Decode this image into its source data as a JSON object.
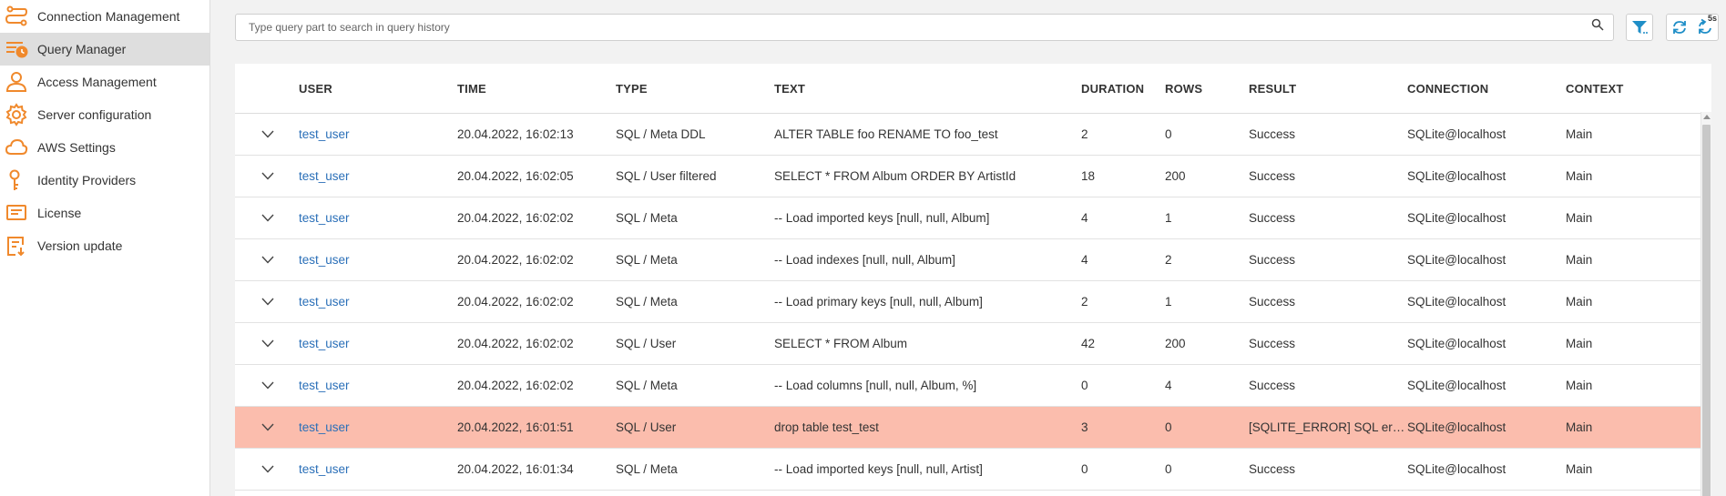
{
  "sidebar": {
    "items": [
      {
        "label": "Connection Management",
        "icon": "connections-icon"
      },
      {
        "label": "Query Manager",
        "icon": "query-manager-icon",
        "active": true
      },
      {
        "label": "Access Management",
        "icon": "user-icon"
      },
      {
        "label": "Server configuration",
        "icon": "gear-icon"
      },
      {
        "label": "AWS Settings",
        "icon": "cloud-icon"
      },
      {
        "label": "Identity Providers",
        "icon": "key-icon"
      },
      {
        "label": "License",
        "icon": "license-icon"
      },
      {
        "label": "Version update",
        "icon": "version-update-icon"
      }
    ]
  },
  "toolbar": {
    "search_placeholder": "Type query part to search in query history",
    "refresh_interval_badge": "5s"
  },
  "table": {
    "columns": [
      "USER",
      "TIME",
      "TYPE",
      "TEXT",
      "DURATION",
      "ROWS",
      "RESULT",
      "CONNECTION",
      "CONTEXT"
    ],
    "rows": [
      {
        "user": "test_user",
        "time": "20.04.2022, 16:02:13",
        "type": "SQL / Meta DDL",
        "text": "ALTER TABLE foo RENAME TO foo_test",
        "duration": "2",
        "rows": "0",
        "result": "Success",
        "connection": "SQLite@localhost",
        "context": "Main"
      },
      {
        "user": "test_user",
        "time": "20.04.2022, 16:02:05",
        "type": "SQL / User filtered",
        "text": "SELECT * FROM Album ORDER BY ArtistId",
        "duration": "18",
        "rows": "200",
        "result": "Success",
        "connection": "SQLite@localhost",
        "context": "Main"
      },
      {
        "user": "test_user",
        "time": "20.04.2022, 16:02:02",
        "type": "SQL / Meta",
        "text": "-- Load imported keys [null, null, Album]",
        "duration": "4",
        "rows": "1",
        "result": "Success",
        "connection": "SQLite@localhost",
        "context": "Main"
      },
      {
        "user": "test_user",
        "time": "20.04.2022, 16:02:02",
        "type": "SQL / Meta",
        "text": "-- Load indexes [null, null, Album]",
        "duration": "4",
        "rows": "2",
        "result": "Success",
        "connection": "SQLite@localhost",
        "context": "Main"
      },
      {
        "user": "test_user",
        "time": "20.04.2022, 16:02:02",
        "type": "SQL / Meta",
        "text": "-- Load primary keys [null, null, Album]",
        "duration": "2",
        "rows": "1",
        "result": "Success",
        "connection": "SQLite@localhost",
        "context": "Main"
      },
      {
        "user": "test_user",
        "time": "20.04.2022, 16:02:02",
        "type": "SQL / User",
        "text": "SELECT * FROM Album",
        "duration": "42",
        "rows": "200",
        "result": "Success",
        "connection": "SQLite@localhost",
        "context": "Main"
      },
      {
        "user": "test_user",
        "time": "20.04.2022, 16:02:02",
        "type": "SQL / Meta",
        "text": "-- Load columns [null, null, Album, %]",
        "duration": "0",
        "rows": "4",
        "result": "Success",
        "connection": "SQLite@localhost",
        "context": "Main"
      },
      {
        "user": "test_user",
        "time": "20.04.2022, 16:01:51",
        "type": "SQL / User",
        "text": "drop table test_test",
        "duration": "3",
        "rows": "0",
        "result": "[SQLITE_ERROR] SQL error or missing database",
        "connection": "SQLite@localhost",
        "context": "Main",
        "error": true
      },
      {
        "user": "test_user",
        "time": "20.04.2022, 16:01:34",
        "type": "SQL / Meta",
        "text": "-- Load imported keys [null, null, Artist]",
        "duration": "0",
        "rows": "0",
        "result": "Success",
        "connection": "SQLite@localhost",
        "context": "Main"
      }
    ]
  },
  "colors": {
    "accent": "#f0892c",
    "link": "#2a6fb8",
    "error_row": "#fbbdad",
    "filter_icon": "#1f8ec7"
  }
}
